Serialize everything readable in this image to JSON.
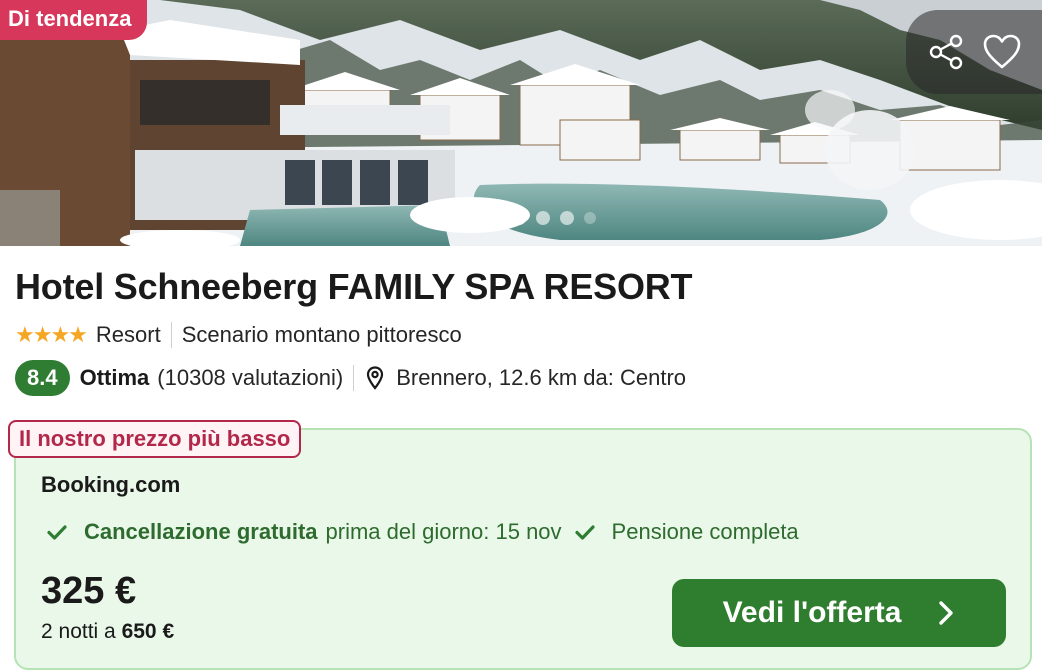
{
  "hero": {
    "badge": "Di tendenza",
    "share_icon": "share-icon",
    "favorite_icon": "heart-icon",
    "slide_count": 4,
    "active_slide": 1
  },
  "hotel": {
    "name": "Hotel Schneeberg FAMILY SPA RESORT",
    "stars": 4,
    "stars_text": "★★★★",
    "type": "Resort",
    "highlight": "Scenario montano pittoresco",
    "score": "8.4",
    "rating_word": "Ottima",
    "reviews": "(10308 valutazioni)",
    "location": "Brennero, 12.6 km da: Centro"
  },
  "offer": {
    "badge": "Il nostro prezzo più basso",
    "provider": "Booking.com",
    "cancellation_strong": "Cancellazione gratuita",
    "cancellation_text": "prima del giorno: 15 nov",
    "board": "Pensione completa",
    "price": "325 €",
    "nights_prefix": "2 notti a",
    "total": "650 €",
    "cta_label": "Vedi l'offerta"
  },
  "colors": {
    "trend_badge": "#d6375a",
    "score_bg": "#2e7d32",
    "offer_bg": "#eaf8ea",
    "offer_border": "#b5e3b5",
    "lowest_price": "#b3284a",
    "cta_bg": "#2f7d2f",
    "stars": "#f5a623"
  }
}
